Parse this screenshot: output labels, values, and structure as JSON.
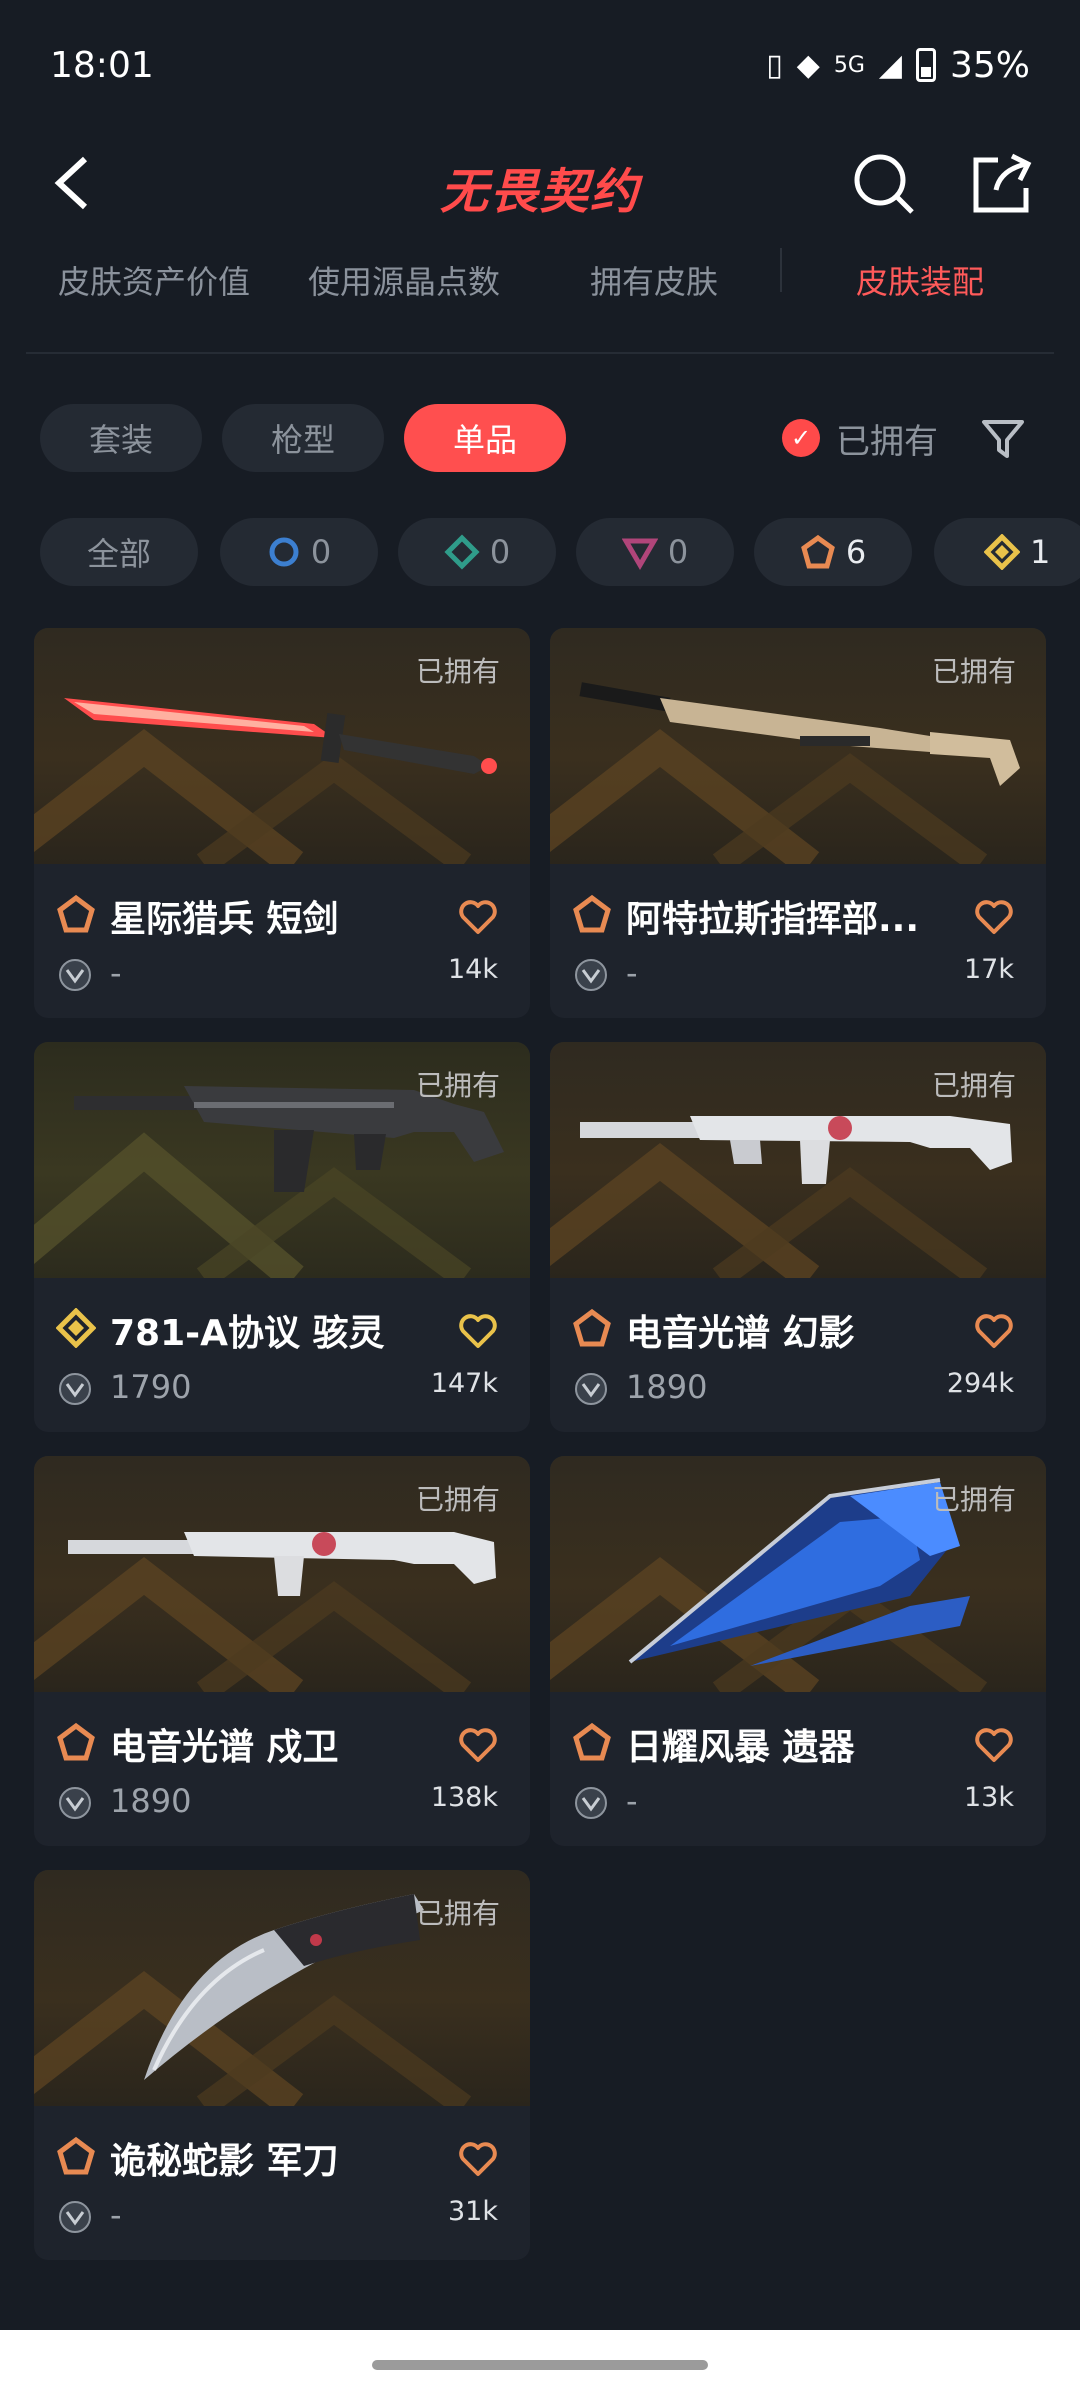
{
  "status_bar": {
    "time": "18:01",
    "network": "5G",
    "battery": "35%"
  },
  "header": {
    "title": "无畏契约"
  },
  "tabs": [
    {
      "label": "皮肤资产价值"
    },
    {
      "label": "使用源晶点数"
    },
    {
      "label": "拥有皮肤"
    },
    {
      "label": "皮肤装配"
    }
  ],
  "filters": {
    "type_pills": [
      {
        "label": "套装"
      },
      {
        "label": "枪型"
      },
      {
        "label": "单品"
      }
    ],
    "owned_label": "已拥有",
    "tiers": [
      {
        "label": "全部"
      },
      {
        "count": "0"
      },
      {
        "count": "0"
      },
      {
        "count": "0"
      },
      {
        "count": "6"
      },
      {
        "count": "1"
      }
    ]
  },
  "items": [
    {
      "name": "星际猎兵 短剑",
      "price": "-",
      "likes": "14k",
      "owned": "已拥有",
      "tier_color": "#e88a52"
    },
    {
      "name": "阿特拉斯指挥部...",
      "price": "-",
      "likes": "17k",
      "owned": "已拥有",
      "tier_color": "#e88a52"
    },
    {
      "name": "781-A协议 骇灵",
      "price": "1790",
      "likes": "147k",
      "owned": "已拥有",
      "tier_color": "#e9c24a"
    },
    {
      "name": "电音光谱 幻影",
      "price": "1890",
      "likes": "294k",
      "owned": "已拥有",
      "tier_color": "#e88a52"
    },
    {
      "name": "电音光谱 戍卫",
      "price": "1890",
      "likes": "138k",
      "owned": "已拥有",
      "tier_color": "#e88a52"
    },
    {
      "name": "日耀风暴 遗器",
      "price": "-",
      "likes": "13k",
      "owned": "已拥有",
      "tier_color": "#e88a52"
    },
    {
      "name": "诡秘蛇影 军刀",
      "price": "-",
      "likes": "31k",
      "owned": "已拥有",
      "tier_color": "#e88a52"
    }
  ],
  "colors": {
    "accent": "#ff4f4f",
    "background": "#171c24",
    "card": "#1e232c",
    "tier_select": "#e88a52",
    "tier_ultra": "#e9c24a",
    "heart_select": "#e88a52",
    "heart_ultra": "#e9c24a"
  }
}
